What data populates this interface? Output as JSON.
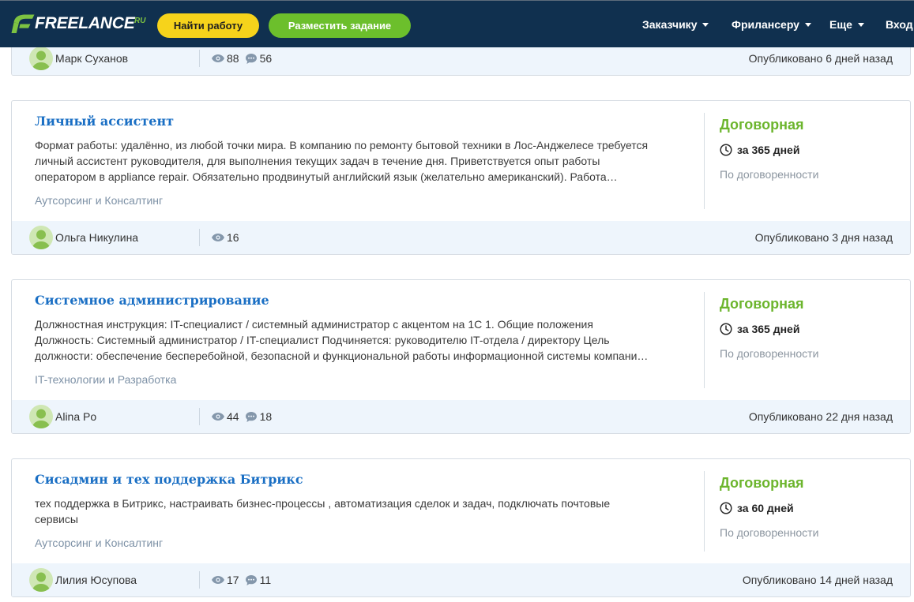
{
  "header": {
    "logo_text": "FREELANCE",
    "logo_suffix": "RU",
    "find_work": "Найти работу",
    "post_task": "Разместить задание",
    "nav": [
      {
        "label": "Заказчику",
        "dropdown": true
      },
      {
        "label": "Фрилансеру",
        "dropdown": true
      },
      {
        "label": "Еще",
        "dropdown": true
      },
      {
        "label": "Вход",
        "dropdown": false
      }
    ]
  },
  "theme": {
    "header_bg": "#10304f",
    "find_work_bg": "#f6d31b",
    "post_task_bg": "#6cbf2c",
    "logo_green": "#7dc242",
    "title": "#1a6fc4",
    "budget": "#6cb52d",
    "footer_bg": "#eef5fc"
  },
  "icons": {
    "logo": "freelance-logo-icon",
    "dropdown": "chevron-down-icon",
    "deadline": "clock-icon",
    "views": "eye-icon",
    "comments": "comment-icon",
    "avatar": "user-avatar-icon"
  },
  "projects": [
    {
      "author": "Марк Суханов",
      "views": "88",
      "comments": "56",
      "published": "Опубликовано 6 дней назад"
    },
    {
      "title": "Личный ассистент",
      "description": [
        "Формат работы: удалённо, из любой точки мира. В компанию по ремонту бытовой техники в Лос-Анджелесе требуется",
        "личный ассистент руководителя, для выполнения текущих задач в течение дня. Приветствуется опыт работы",
        "оператором в appliance repair. Обязательно продвинутый английский язык (желательно американский). Работа…"
      ],
      "category": "Аутсорсинг и Консалтинг",
      "budget": "Договорная",
      "deadline": "за 365 дней",
      "payment_terms": "По договоренности",
      "author": "Ольга Никулина",
      "views": "16",
      "published": "Опубликовано 3 дня назад"
    },
    {
      "title": "Системное администрирование",
      "description": [
        "Должностная инструкция: IT-специалист / системный администратор с акцентом на 1С 1. Общие положения",
        "Должность: Системный администратор / IT-специалист Подчиняется: руководителю IT-отдела / директору Цель",
        "должности: обеспечение бесперебойной, безопасной и функциональной работы информационной системы компани…"
      ],
      "category": "IT-технологии и Разработка",
      "budget": "Договорная",
      "deadline": "за 365 дней",
      "payment_terms": "По договоренности",
      "author": "Alina Po",
      "views": "44",
      "comments": "18",
      "published": "Опубликовано 22 дня назад"
    },
    {
      "title": "Сисадмин и тех поддержка Битрикс",
      "description": [
        "тех поддержка в Битрикс, настраивать бизнес-процессы , автоматизация сделок и задач, подключать почтовые",
        "сервисы"
      ],
      "category": "Аутсорсинг и Консалтинг",
      "budget": "Договорная",
      "deadline": "за 60 дней",
      "payment_terms": "По договоренности",
      "author": "Лилия Юсупова",
      "views": "17",
      "comments": "11",
      "published": "Опубликовано 14 дней назад"
    }
  ]
}
